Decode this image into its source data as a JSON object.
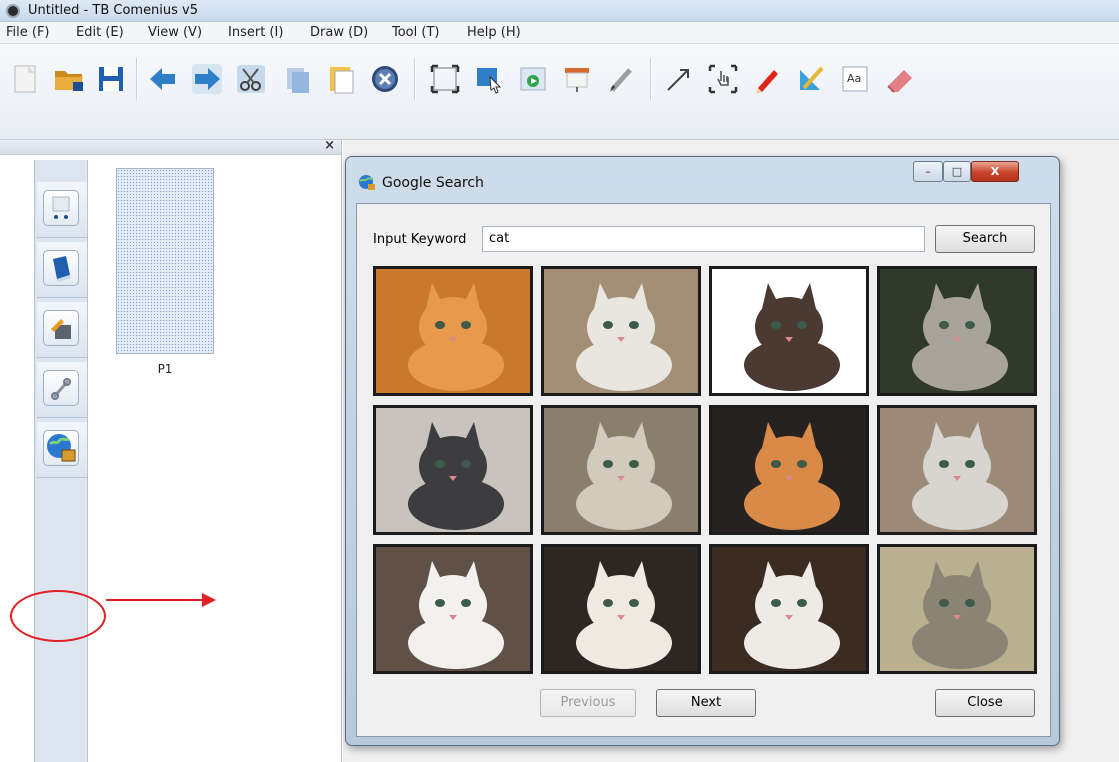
{
  "window": {
    "title": "Untitled - TB Comenius v5"
  },
  "menu": [
    {
      "label": "File (F)"
    },
    {
      "label": "Edit (E)"
    },
    {
      "label": "View (V)"
    },
    {
      "label": "Insert (I)"
    },
    {
      "label": "Draw (D)"
    },
    {
      "label": "Tool (T)"
    },
    {
      "label": "Help (H)"
    }
  ],
  "toolbar": {
    "buttons": [
      "new-icon",
      "open-folder-icon",
      "save-icon",
      "back-icon",
      "forward-icon",
      "cut-icon",
      "copy-icon",
      "paste-icon",
      "delete-icon",
      "fullscreen-icon",
      "pointer-icon",
      "play-icon",
      "screen-icon",
      "brush-icon",
      "arrow-pen-icon",
      "hand-icon",
      "pencil-icon",
      "ruler-icon",
      "text-icon",
      "eraser-icon"
    ],
    "text_button_label": "Aa"
  },
  "left_panel": {
    "close_glyph": "×",
    "tabs": [
      "pages-icon",
      "book-icon",
      "tools-icon",
      "link-icon",
      "web-search-icon"
    ],
    "page_label": "P1"
  },
  "dialog": {
    "title": "Google Search",
    "window_buttons": {
      "minimize": "–",
      "maximize": "□",
      "close": "X"
    },
    "keyword_label": "Input Keyword",
    "keyword_value": "cat",
    "search_label": "Search",
    "previous_label": "Previous",
    "next_label": "Next",
    "close_label": "Close",
    "results": [
      {
        "name": "orange-kitten",
        "bg": "#c9782c",
        "fg": "#e79a4b",
        "border": "#ffffff"
      },
      {
        "name": "tabby-white-cat",
        "bg": "#a28f76",
        "fg": "#e9e6df",
        "border": "#ffffff"
      },
      {
        "name": "calico-kitten",
        "bg": "#ffffff",
        "fg": "#4a3a31",
        "border": "#ffffff"
      },
      {
        "name": "silver-tabby",
        "bg": "#2f3a2a",
        "fg": "#a9a49a",
        "border": "#ffffff"
      },
      {
        "name": "grey-white-kitten",
        "bg": "#c8c3bd",
        "fg": "#3d3d3f",
        "border": "#ffffff"
      },
      {
        "name": "two-tabbies",
        "bg": "#8a7f6d",
        "fg": "#d2cbbd",
        "border": "#ffffff"
      },
      {
        "name": "meowing-kitten",
        "bg": "#262222",
        "fg": "#d98a46",
        "border": "#ffffff"
      },
      {
        "name": "fluffy-grey",
        "bg": "#9c8a79",
        "fg": "#d8d4cf",
        "border": "#ffffff"
      },
      {
        "name": "white-persian",
        "bg": "#5f5148",
        "fg": "#f2f1ee",
        "border": "#ffffff"
      },
      {
        "name": "fat-white-cat",
        "bg": "#2e2622",
        "fg": "#efe9e1",
        "border": "#ffffff"
      },
      {
        "name": "white-kitten",
        "bg": "#3a2c22",
        "fg": "#eeebe6",
        "border": "#ffffff"
      },
      {
        "name": "sleeping-tabby",
        "bg": "#b9b08f",
        "fg": "#8b8474",
        "border": "#ffffff"
      }
    ]
  },
  "colors": {
    "accent_red": "#e31e24",
    "toolbar_blue": "#2f7fc8"
  }
}
